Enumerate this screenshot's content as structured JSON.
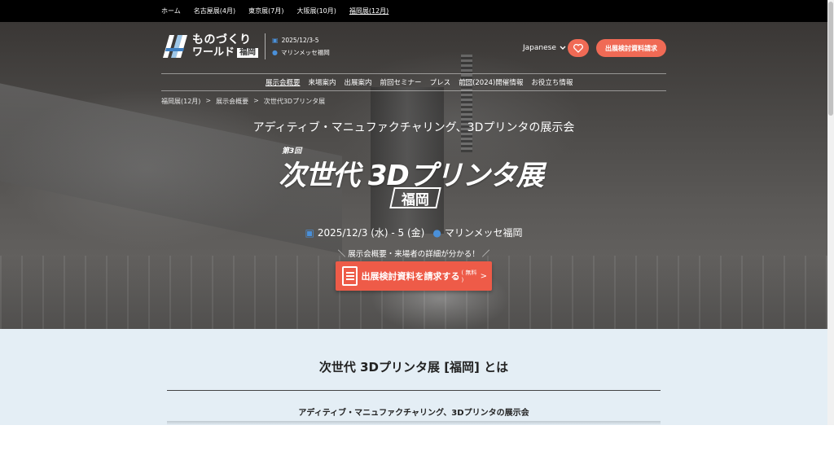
{
  "topbar": {
    "links": [
      "ホーム",
      "名古屋展(4月)",
      "東京展(7月)",
      "大阪展(10月)",
      "福岡展(12月)"
    ]
  },
  "header": {
    "logo_line1": "ものづくり",
    "logo_line2": "ワールド",
    "logo_badge": "福岡",
    "date": "2025/12/3-5",
    "venue": "マリンメッセ福岡",
    "language": "Japanese",
    "cta_label": "出展検討資料請求"
  },
  "nav": {
    "items": [
      "展示会概要",
      "来場案内",
      "出展案内",
      "前回セミナー",
      "プレス",
      "前回(2024)開催情報",
      "お役立ち情報"
    ]
  },
  "breadcrumb": {
    "items": [
      "福岡展(12月)",
      "展示会概要",
      "次世代3Dプリンタ展"
    ],
    "separator": ">"
  },
  "hero": {
    "subtitle": "アディティブ・マニュファクチャリング、3Dプリンタの展示会",
    "edition": "第3回",
    "title": "次世代 3Dプリンタ展",
    "title_badge": "福岡",
    "date": "2025/12/3 (水) - 5 (金)",
    "venue": "マリンメッセ福岡",
    "note": "＼ 展示会概要・来場者の詳細が分かる！ ／",
    "cta_label": "出展検討資料を請求する",
    "cta_free": "( 無料 )",
    "cta_arrow": ">"
  },
  "about": {
    "heading": "次世代 3Dプリンタ展 [福岡] とは",
    "subheading": "アディティブ・マニュファクチャリング、3Dプリンタの展示会"
  },
  "colors": {
    "accent": "#ee5b48",
    "icon_blue": "#4a90d9",
    "about_bg": "#e4eef5"
  }
}
